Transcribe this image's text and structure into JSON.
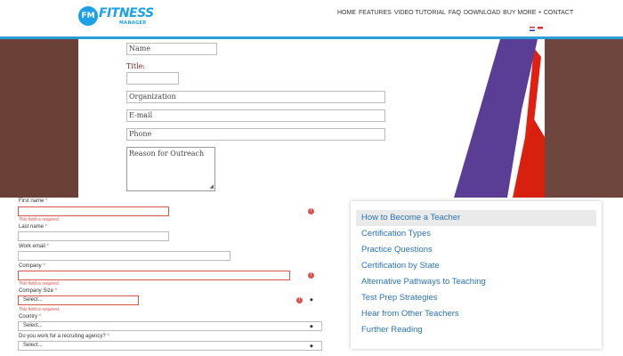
{
  "header": {
    "logo_badge": "FM",
    "logo_word": "FITNESS",
    "logo_sub": "MANAGER",
    "nav": [
      "HOME",
      "FEATURES",
      "VIDEO TUTORIAL",
      "FAQ",
      "DOWNLOAD",
      "BUY MORE",
      "CONTACT"
    ],
    "colors": {
      "brand": "#1ea0e6",
      "rule": "#2a9fd6"
    }
  },
  "upper_form": {
    "name_placeholder": "Name",
    "title_label": "Title:",
    "organization_placeholder": "Organization",
    "email_placeholder": "E-mail",
    "phone_placeholder": "Phone",
    "reason_placeholder": "Reason for Outreach"
  },
  "lower_form": {
    "first_name_label": "First name",
    "last_name_label": "Last name",
    "work_email_label": "Work email",
    "company_label": "Company",
    "company_size_label": "Company Size",
    "country_label": "Country",
    "recruiting_label": "Do you work for a recruiting agency?",
    "required_mark": "*",
    "error_text": "This field is required.",
    "error_icon": "!",
    "select_placeholder": "Select...",
    "select_arrow": "◆",
    "colors": {
      "error": "#d9534f"
    }
  },
  "links": {
    "items": [
      "How to Become a Teacher",
      "Certification Types",
      "Practice Questions",
      "Certification by State",
      "Alternative Pathways to Teaching",
      "Test Prep Strategies",
      "Hear from Other Teachers",
      "Further Reading"
    ],
    "active_index": 0,
    "colors": {
      "link": "#2a73b7",
      "active_bg": "#eaeaea"
    }
  }
}
